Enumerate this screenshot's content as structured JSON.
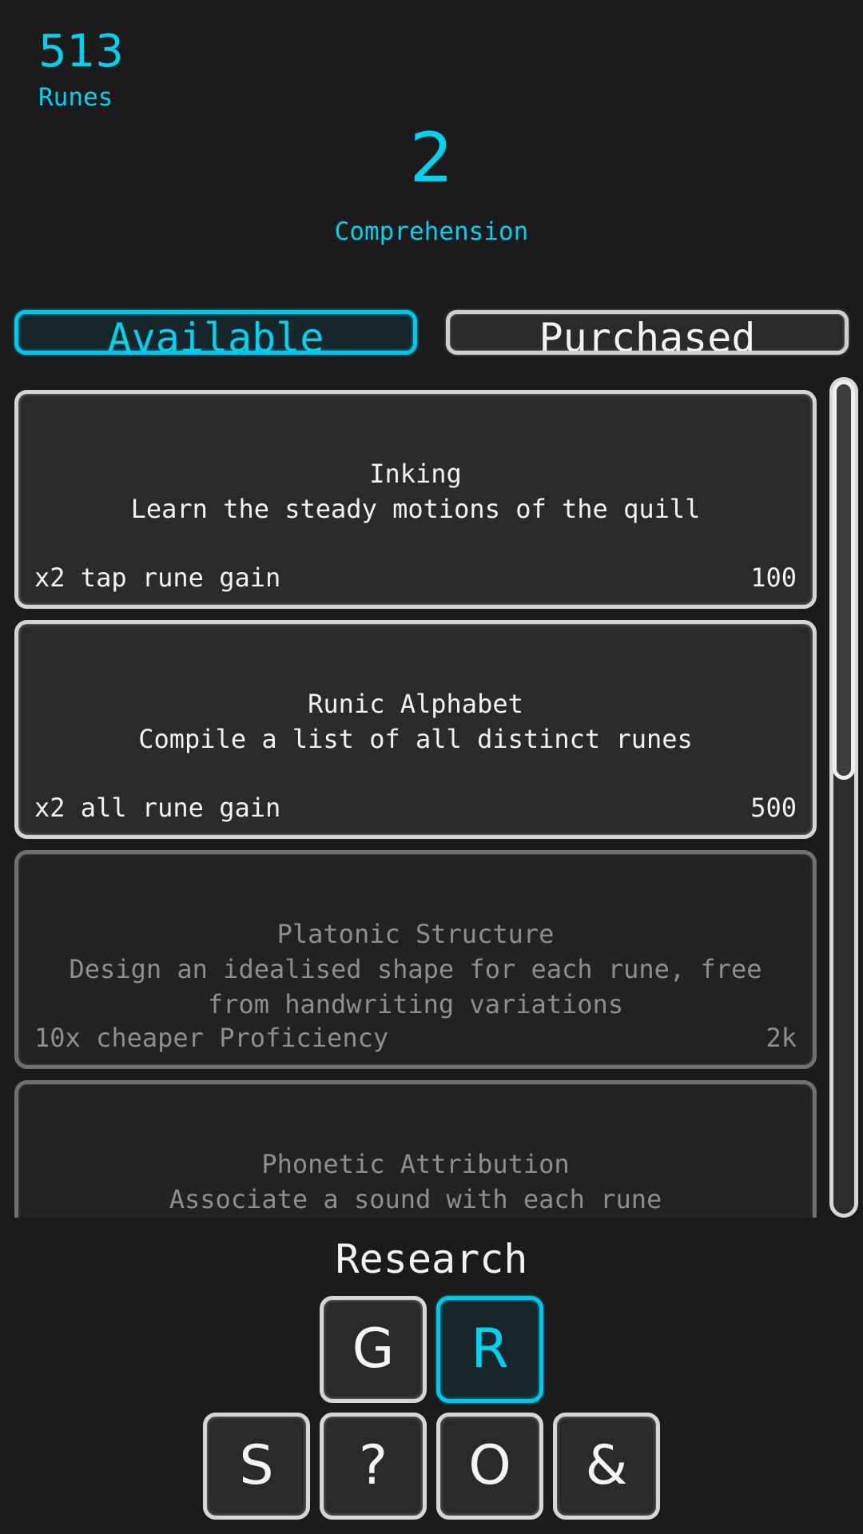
{
  "stats": {
    "runes": {
      "value": "513",
      "label": "Runes"
    },
    "comprehension": {
      "value": "2",
      "label": "Comprehension"
    }
  },
  "colors": {
    "accent": "#00d2f0",
    "background": "#1b1b1b",
    "card": "#2a2a2a",
    "locked_text": "#8e8e8e"
  },
  "tabs": [
    {
      "label": "Available",
      "active": true
    },
    {
      "label": "Purchased",
      "active": false
    }
  ],
  "research_items": [
    {
      "title": "Inking",
      "description": "Learn the steady motions of the quill",
      "effect": "x2 tap rune gain",
      "cost": "100",
      "affordable": true
    },
    {
      "title": "Runic Alphabet",
      "description": "Compile a list of all distinct runes",
      "effect": "x2 all rune gain",
      "cost": "500",
      "affordable": true
    },
    {
      "title": "Platonic Structure",
      "description": "Design an idealised shape for each rune, free from handwriting variations",
      "effect": "10x cheaper Proficiency",
      "cost": "2k",
      "affordable": false
    },
    {
      "title": "Phonetic Attribution",
      "description": "Associate a sound with each rune",
      "effect": "",
      "cost": "",
      "affordable": false
    }
  ],
  "scroll": {
    "position_fraction": 0.0,
    "visible_fraction": 0.48
  },
  "nav": {
    "section_title": "Research",
    "top_row": [
      {
        "label": "G",
        "active": false
      },
      {
        "label": "R",
        "active": true
      }
    ],
    "bottom_row": [
      {
        "label": "S",
        "active": false
      },
      {
        "label": "?",
        "active": false
      },
      {
        "label": "O",
        "active": false
      },
      {
        "label": "&",
        "active": false
      }
    ]
  }
}
